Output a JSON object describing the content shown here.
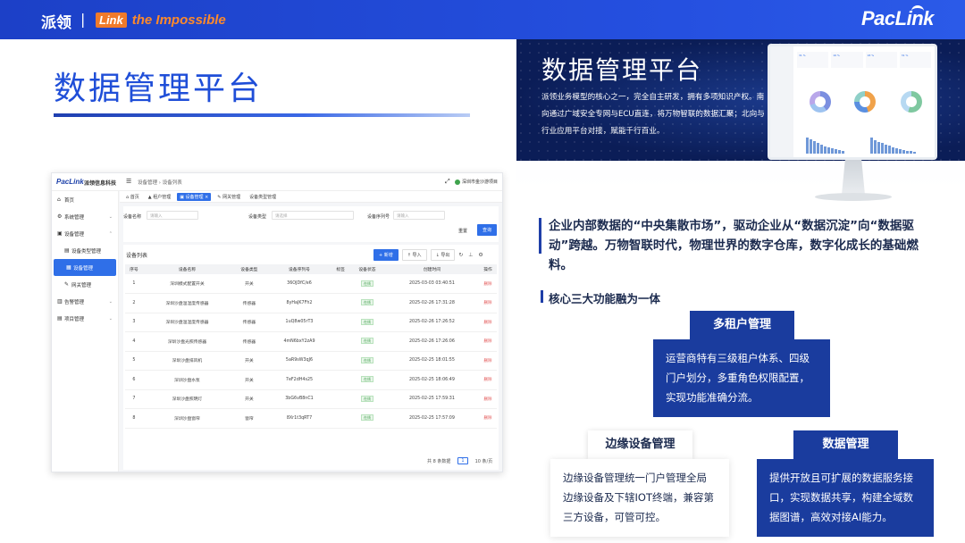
{
  "header": {
    "brand_cn": "派领",
    "separator": "|",
    "slogan_link": "Link",
    "slogan_rest": "the Impossible",
    "logo": "PacLink"
  },
  "left": {
    "title": "数据管理平台"
  },
  "app": {
    "logo": "PacLink",
    "name": "派领信息科技",
    "menu_icon": "☰",
    "breadcrumb": "设备管理 › 设备列表",
    "user": "深圳市金沙游项目",
    "sidebar": [
      {
        "label": "首页",
        "icon": "⌂"
      },
      {
        "label": "系统管理",
        "icon": "⚙",
        "chev": "⌄"
      },
      {
        "label": "设备管理",
        "icon": "▣",
        "chev": "⌃"
      },
      {
        "label": "设备类型管理",
        "icon": "▤"
      },
      {
        "label": "设备管理",
        "icon": "▦"
      },
      {
        "label": "网关管理",
        "icon": "✎"
      },
      {
        "label": "告警管理",
        "icon": "▥",
        "chev": "⌄"
      },
      {
        "label": "项目管理",
        "icon": "▤",
        "chev": "⌄"
      }
    ],
    "tabs": [
      "⌂ 首页",
      "▲ 租户管理",
      "▣ 设备管理 ×",
      "✎ 网关管理",
      "设备类型管理"
    ],
    "filters": {
      "name_label": "设备名称",
      "name_ph": "请输入",
      "type_label": "设备类型",
      "type_ph": "请选择",
      "serial_label": "设备序列号",
      "serial_ph": "请输入",
      "reset": "重置",
      "query": "查询"
    },
    "list_title": "设备列表",
    "tools": {
      "add": "+ 新增",
      "import": "↑ 导入",
      "export": "↓ 导出",
      "icons": "↻ ⊥ ⚙"
    },
    "columns": [
      "序号",
      "设备名称",
      "设备类型",
      "设备序列号",
      "标签",
      "设备状态",
      "创建时间",
      "操作"
    ],
    "rows": [
      {
        "no": "1",
        "name": "深圳模式配置开关",
        "type": "开关",
        "serial": "36OJDfC/e6",
        "tag": "",
        "status": "在线",
        "time": "2025-03-03 03:40:51",
        "op": "删除"
      },
      {
        "no": "2",
        "name": "深圳沙盘温湿度传感器",
        "type": "传感器",
        "serial": "8yHaJK7Fh2",
        "tag": "",
        "status": "在线",
        "time": "2025-02-26 17:31:28",
        "op": "删除"
      },
      {
        "no": "3",
        "name": "深圳沙盘温湿度传感器",
        "type": "传感器",
        "serial": "1uQ8w05rT3",
        "tag": "",
        "status": "在线",
        "time": "2025-02-26 17:26:52",
        "op": "删除"
      },
      {
        "no": "4",
        "name": "深圳沙盘光照传感器",
        "type": "传感器",
        "serial": "4mN6bxY2zA9",
        "tag": "",
        "status": "在线",
        "time": "2025-02-26 17:26:06",
        "op": "删除"
      },
      {
        "no": "5",
        "name": "深圳沙盘排风机",
        "type": "开关",
        "serial": "5aR9sW3qJ6",
        "tag": "",
        "status": "在线",
        "time": "2025-02-25 18:01:55",
        "op": "删除"
      },
      {
        "no": "6",
        "name": "深圳沙盘水泵",
        "type": "开关",
        "serial": "7eF2dH4s25",
        "tag": "",
        "status": "在线",
        "time": "2025-02-25 18:06:49",
        "op": "删除"
      },
      {
        "no": "7",
        "name": "深圳沙盘照明灯",
        "type": "开关",
        "serial": "3bG6vB8nC1",
        "tag": "",
        "status": "在线",
        "time": "2025-02-25 17:59:31",
        "op": "删除"
      },
      {
        "no": "8",
        "name": "深圳沙盘窗帘",
        "type": "窗帘",
        "serial": "8Xr1t3qRT7",
        "tag": "",
        "status": "在线",
        "time": "2025-02-25 17:57:09",
        "op": "删除"
      }
    ],
    "pager": {
      "total": "共 8 条数据",
      "page": "1",
      "size": "10 条/页"
    }
  },
  "hero": {
    "title": "数据管理平台",
    "desc": "派领业务模型的核心之一，完全自主研发，拥有多项知识产权。南向通过广域安全专网与ECU直连，将万物智联的数据汇聚；北向与行业应用平台对接，赋能千行百业。"
  },
  "monitor": {
    "cards": [
      "31 %",
      "16 %",
      "18 %",
      "31 %"
    ]
  },
  "quote": "企业内部数据的“中央集散市场”，驱动企业从“数据沉淀”向“数据驱动”跨越。万物智联时代，物理世界的数字仓库，数字化成长的基础燃料。",
  "section": "核心三大功能融为一体",
  "cards": [
    {
      "title": "多租户管理",
      "body": "运营商特有三级租户体系、四级门户划分，多重角色权限配置，实现功能准确分流。"
    },
    {
      "title": "边缘设备管理",
      "body": "边缘设备管理统一门户管理全局边缘设备及下辖IOT终端，兼容第三方设备，可管可控。"
    },
    {
      "title": "数据管理",
      "body": "提供开放且可扩展的数据服务接口，实现数据共享，构建全域数据图谱，高效对接AI能力。"
    }
  ],
  "colors": {
    "primary": "#1f4ed8",
    "navy": "#1a3c9e",
    "orange": "#f07a2a",
    "online": "#46a152"
  }
}
